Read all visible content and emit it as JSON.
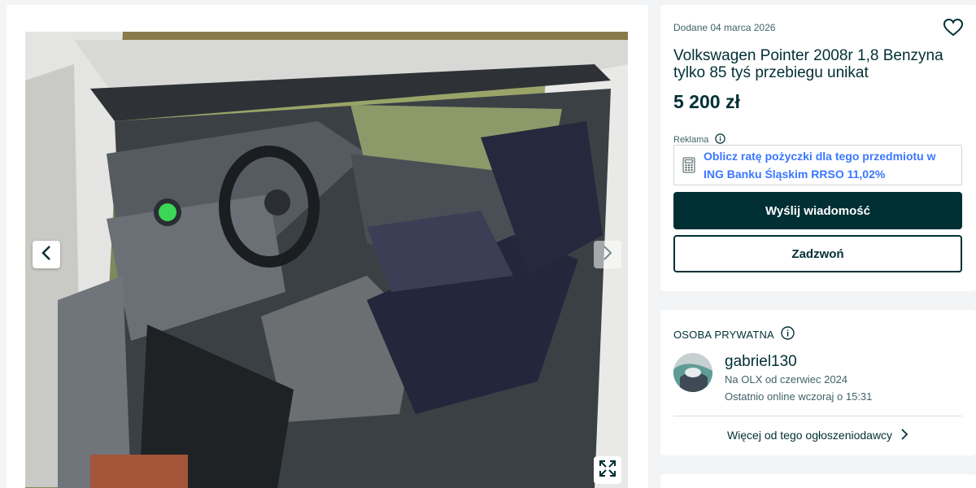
{
  "gallery": {
    "prev_icon": "chevron-left-icon",
    "next_icon": "chevron-right-icon",
    "fullscreen_icon": "expand-icon"
  },
  "listing": {
    "added": "Dodane 04 marca 2026",
    "title": "Volkswagen Pointer 2008r 1,8 Benzyna tylko 85 tyś przebiegu unikat",
    "price": "5 200 zł",
    "favorite_icon": "heart-icon"
  },
  "ad": {
    "label": "Reklama",
    "info_icon": "info-icon",
    "icon": "calculator-icon",
    "text": "Oblicz ratę pożyczki dla tego przedmiotu w ING Banku Śląskim RRSO 11,02%"
  },
  "actions": {
    "message": "Wyślij wiadomość",
    "call": "Zadzwoń"
  },
  "seller": {
    "type": "OSOBA PRYWATNA",
    "name": "gabriel130",
    "since": "Na OLX od czerwiec 2024",
    "last_online": "Ostatnio online wczoraj o 15:31",
    "more": "Więcej od tego ogłoszeniodawcy"
  },
  "colors": {
    "brand_dark": "#002f34",
    "link_blue": "#3a77ff",
    "muted": "#406367",
    "page_bg": "#f2f4f5"
  }
}
